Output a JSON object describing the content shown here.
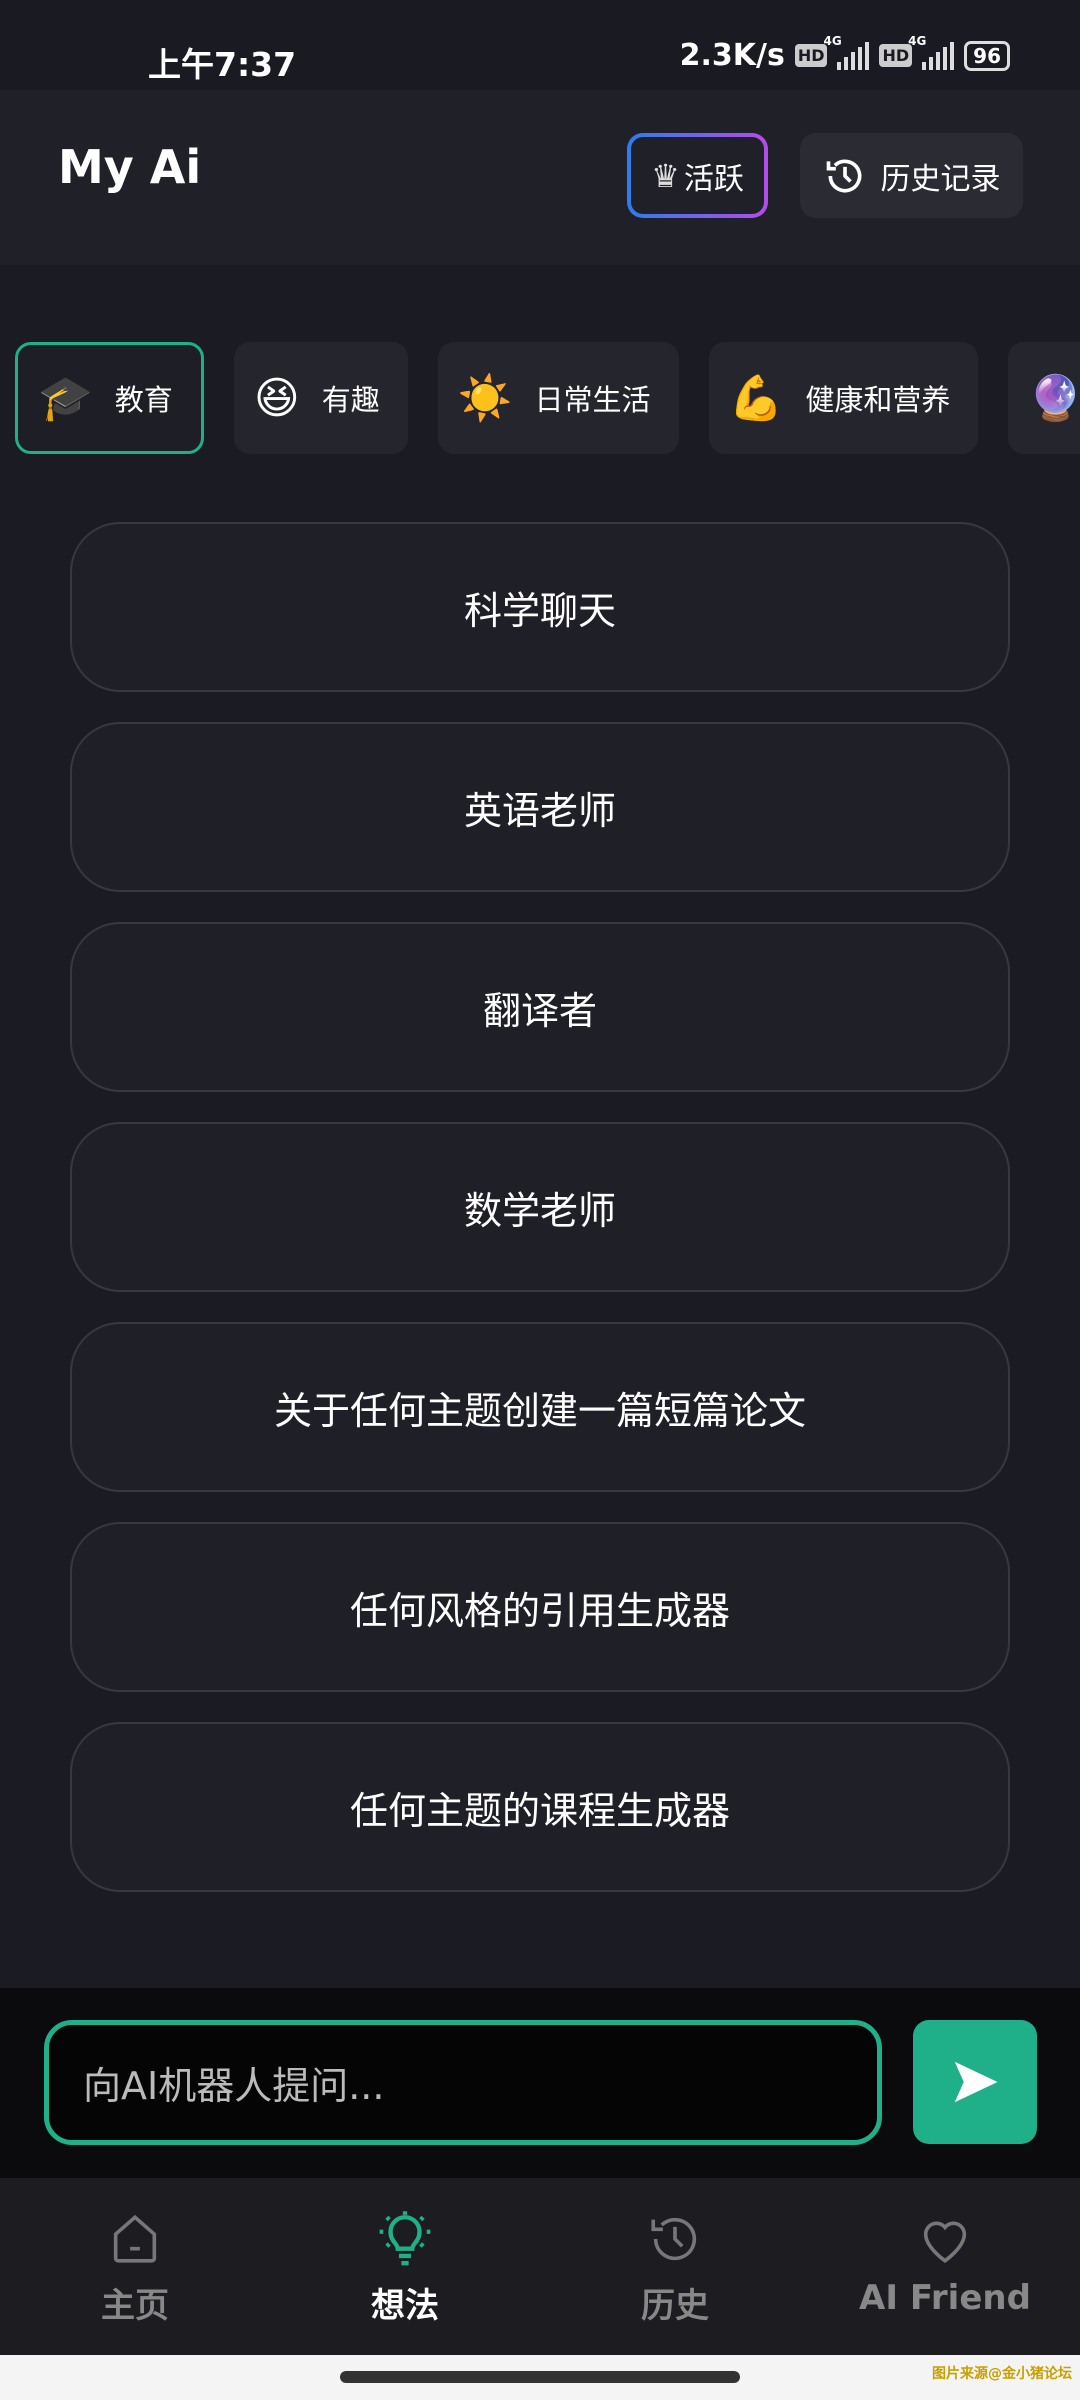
{
  "status_bar": {
    "time": "上午7:37",
    "net_speed": "2.3K/s",
    "hd1": "HD",
    "net1": "4G",
    "hd2": "HD",
    "net2": "4G",
    "battery": "96"
  },
  "header": {
    "title": "My Ai",
    "active_label": "活跃",
    "history_label": "历史记录"
  },
  "categories": [
    {
      "emoji": "🎓",
      "label": "教育",
      "selected": true
    },
    {
      "emoji": "😆",
      "label": "有趣"
    },
    {
      "emoji": "☀️",
      "label": "日常生活"
    },
    {
      "emoji": "💪",
      "label": "健康和营养"
    },
    {
      "emoji": "🔮",
      "label": ""
    }
  ],
  "prompts": [
    "科学聊天",
    "英语老师",
    "翻译者",
    "数学老师",
    "关于任何主题创建一篇短篇论文",
    "任何风格的引用生成器",
    "任何主题的课程生成器"
  ],
  "input": {
    "placeholder": "向AI机器人提问..."
  },
  "nav": [
    {
      "label": "主页",
      "icon": "home-icon"
    },
    {
      "label": "想法",
      "icon": "lightbulb-icon",
      "selected": true
    },
    {
      "label": "历史",
      "icon": "history-icon"
    },
    {
      "label": "AI Friend",
      "icon": "heart-icon"
    }
  ],
  "watermark": "图片来源@金小猪论坛",
  "colors": {
    "accent": "#1fb08a",
    "background": "#1b1c23"
  }
}
